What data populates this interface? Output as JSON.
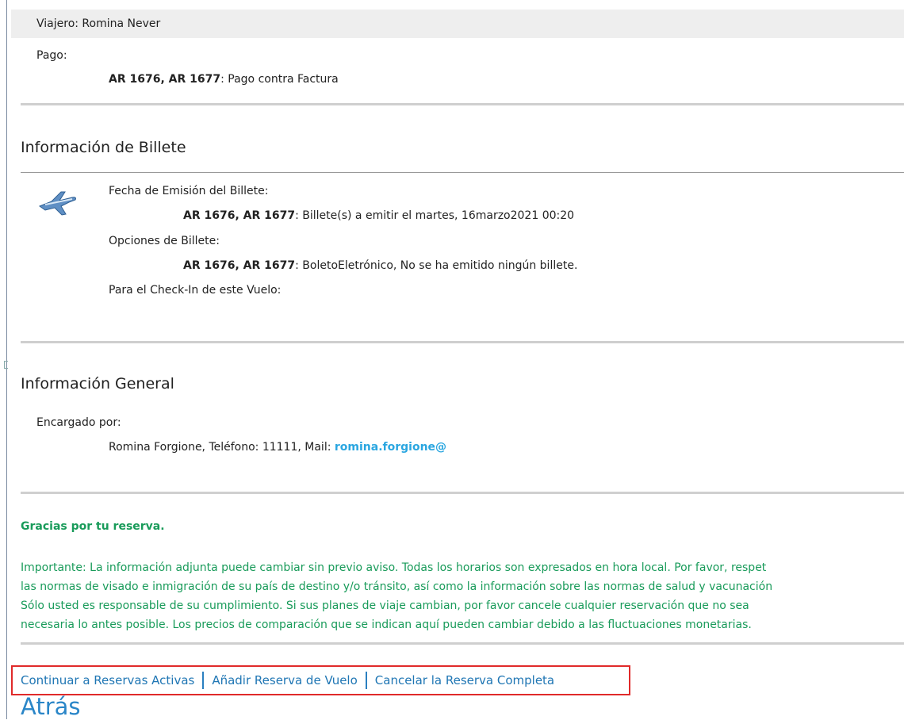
{
  "traveler": {
    "label": "Viajero: Romina Never"
  },
  "payment": {
    "label": "Pago:",
    "flights": "AR 1676, AR 1677",
    "method": ": Pago contra Factura"
  },
  "ticket_info": {
    "title": "Información de Billete",
    "issue_date_label": "Fecha de Emisión del Billete:",
    "issue_date_flights": "AR 1676, AR 1677",
    "issue_date_value": ": Billete(s) a emitir el martes, 16marzo2021 00:20",
    "options_label": "Opciones de Billete:",
    "options_flights": "AR 1676, AR 1677",
    "options_value": ": BoletoEletrónico, No se ha emitido ningún billete.",
    "checkin_label": "Para el Check-In de este Vuelo:"
  },
  "general_info": {
    "title": "Información General",
    "booked_by_label": "Encargado por:",
    "booked_by_value": "Romina Forgione, Teléfono: 11111, Mail: ",
    "email": "romina.forgione@"
  },
  "thanks": "Gracias por tu reserva.",
  "notice_lines": [
    "Importante: La información adjunta puede cambiar sin previo aviso. Todas los horarios son expresados en hora local. Por favor, respet",
    "las normas de visado e inmigración de su país de destino y/o tránsito, así como la información sobre las normas de salud y vacunación",
    "Sólo usted es responsable de su cumplimiento. Si sus planes de viaje cambian, por favor cancele cualquier reservación que no sea",
    "necesaria lo antes posible. Los precios de comparación que se indican aquí pueden cambiar debido a las fluctuaciones monetarias."
  ],
  "actions": {
    "continue": "Continuar a Reservas Activas",
    "add_flight": "Añadir Reserva de Vuelo",
    "cancel_all": "Cancelar la Reserva Completa"
  },
  "back_label": "Atrás",
  "colors": {
    "link": "#2aa6e0",
    "green_text": "#199b5a",
    "action_border": "#e02a2a",
    "action_text": "#1f76b4"
  }
}
